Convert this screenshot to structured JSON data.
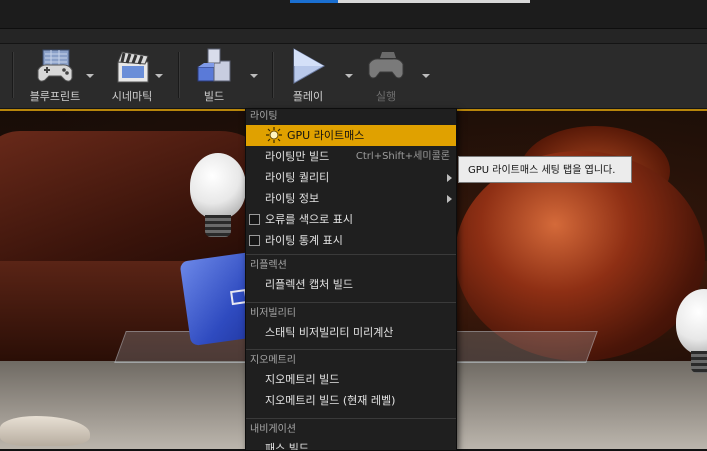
{
  "toolbar": {
    "buttons": [
      {
        "label": "블루프린트",
        "icon": "blueprint-gamepad-icon"
      },
      {
        "label": "시네마틱",
        "icon": "cinematics-clapper-icon"
      },
      {
        "label": "빌드",
        "icon": "build-blocks-icon"
      },
      {
        "label": "플레이",
        "icon": "play-icon"
      },
      {
        "label": "실행",
        "icon": "launch-gamepad-icon"
      }
    ]
  },
  "menu": {
    "sections": [
      {
        "header": "라이팅",
        "items": [
          {
            "label": "GPU 라이트매스",
            "icon": "gpu-lightmass-sun-icon",
            "highlighted": true
          },
          {
            "label": "라이팅만 빌드",
            "shortcut": "Ctrl+Shift+세미콜론"
          },
          {
            "label": "라이팅 퀄리티",
            "submenu": true
          },
          {
            "label": "라이팅 정보",
            "submenu": true
          },
          {
            "label": "오류를 색으로 표시",
            "checkbox": true
          },
          {
            "label": "라이팅 통계 표시",
            "checkbox": true
          }
        ]
      },
      {
        "header": "리플렉션",
        "items": [
          {
            "label": "리플렉션 캡처 빌드"
          }
        ]
      },
      {
        "header": "비저빌리티",
        "items": [
          {
            "label": "스태틱 비저빌리티 미리계산"
          }
        ]
      },
      {
        "header": "지오메트리",
        "items": [
          {
            "label": "지오메트리 빌드"
          },
          {
            "label": "지오메트리 빌드 (현재 레벨)"
          }
        ]
      },
      {
        "header": "내비게이션",
        "items": [
          {
            "label": "패스 빌드"
          }
        ]
      }
    ]
  },
  "tooltip": {
    "text": "GPU 라이트매스 세팅 탭을 엽니다."
  },
  "colors": {
    "highlight": "#e0a100",
    "menu_bg": "#1f1f1f",
    "toolbar_bg": "#2b2b2b"
  }
}
